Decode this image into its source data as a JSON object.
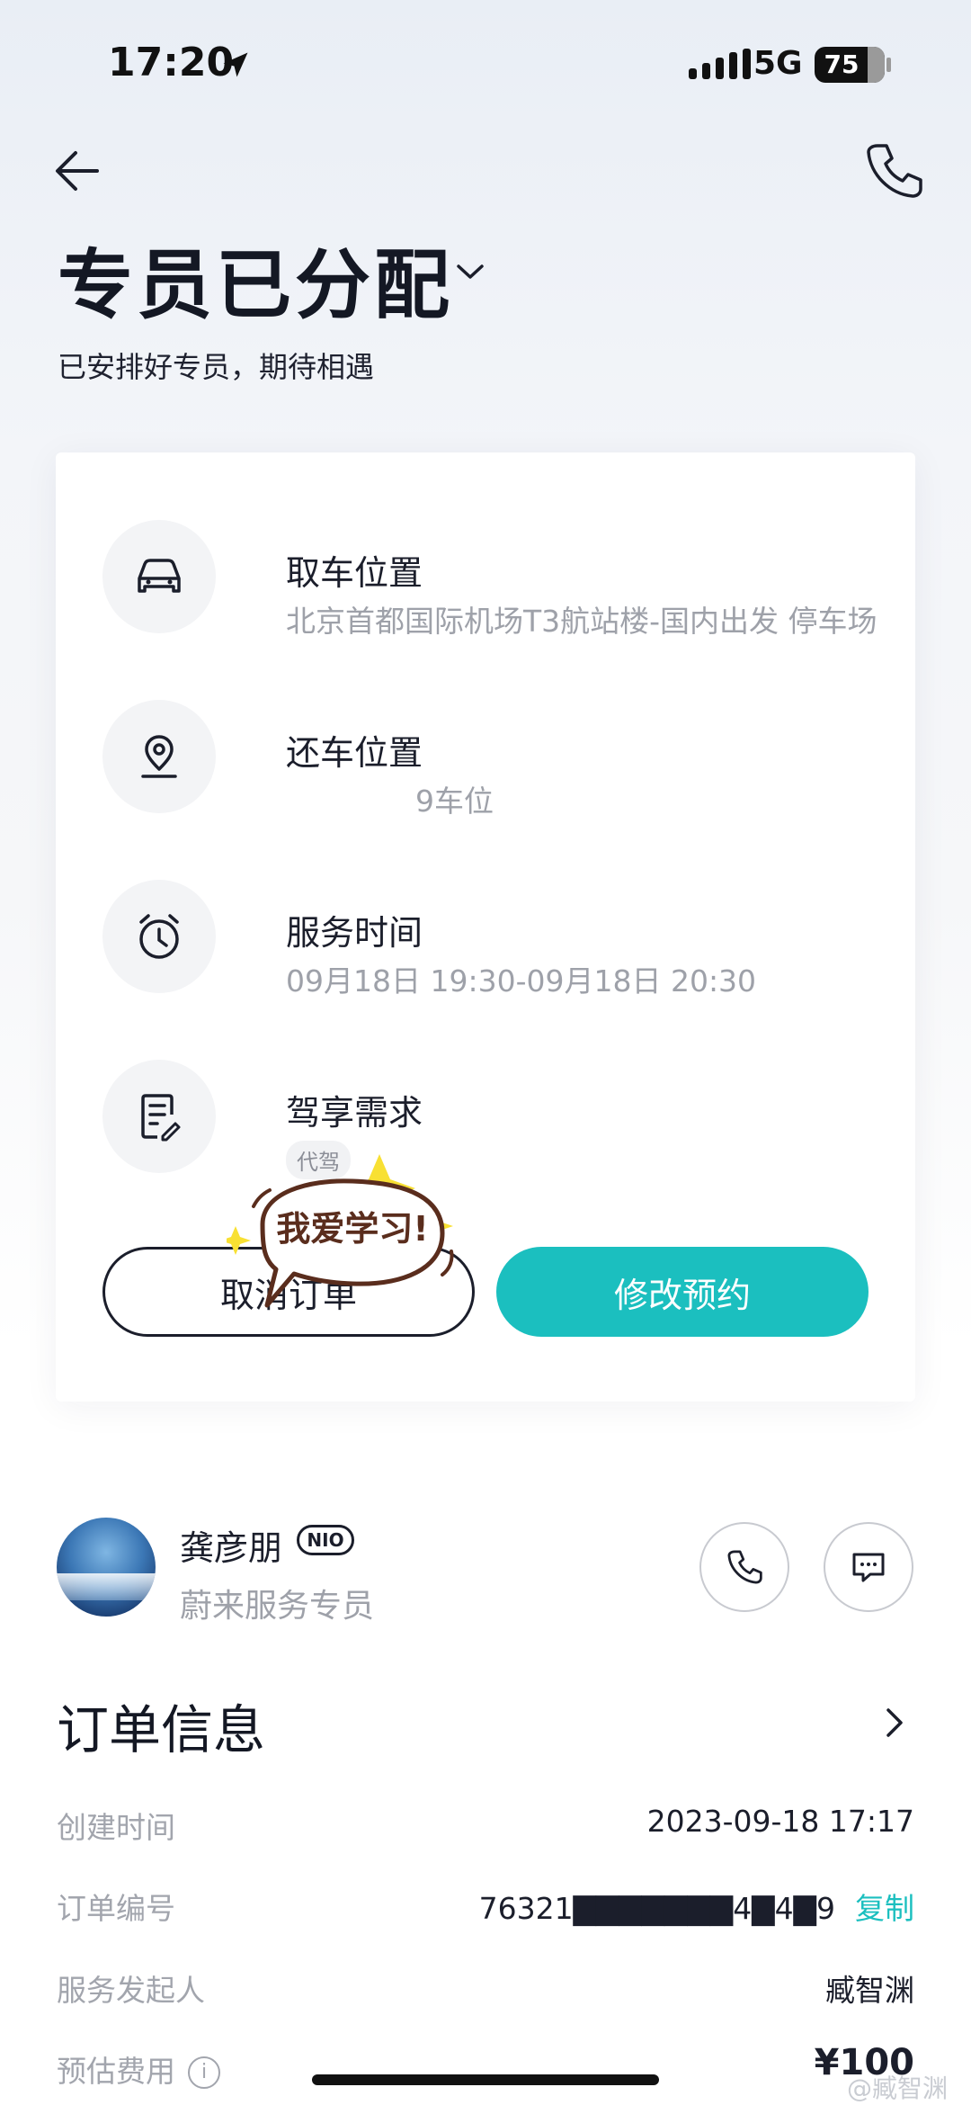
{
  "status_bar": {
    "time": "17:20",
    "network": "5G",
    "battery": "75",
    "battery_level_percent": 75
  },
  "header": {
    "title": "专员已分配",
    "subtitle": "已安排好专员，期待相遇"
  },
  "details": {
    "pickup": {
      "label": "取车位置",
      "value": "北京首都国际机场T3航站楼-国内出发 停车场"
    },
    "return": {
      "label": "还车位置",
      "value": "9车位"
    },
    "service_time": {
      "label": "服务时间",
      "value": "09月18日 19:30-09月18日 20:30"
    },
    "request": {
      "label": "驾享需求",
      "tag": "代驾"
    }
  },
  "actions": {
    "cancel": "取消订单",
    "modify": "修改预约"
  },
  "sticker": {
    "text": "我爱学习!"
  },
  "agent": {
    "name": "龚彦朋",
    "badge": "NIO",
    "role": "蔚来服务专员"
  },
  "order": {
    "title": "订单信息",
    "created_label": "创建时间",
    "created_value": "2023-09-18 17:17",
    "number_label": "订单编号",
    "number_value": "76321▇▇▇▇▇▇▇4▇4▇9",
    "copy": "复制",
    "initiator_label": "服务发起人",
    "initiator_value": "臧智渊",
    "fee_label": "预估费用",
    "fee_value": "¥100"
  },
  "watermark": "@臧智渊",
  "colors": {
    "accent": "#1bbfbf",
    "text": "#1b1e2b",
    "muted": "#9ea1a9"
  },
  "icons": [
    "location-arrow-icon",
    "back-arrow-icon",
    "phone-icon",
    "chevron-down-icon",
    "car-icon",
    "map-pin-icon",
    "alarm-clock-icon",
    "note-edit-icon",
    "chat-icon",
    "chevron-right-icon",
    "info-icon"
  ]
}
